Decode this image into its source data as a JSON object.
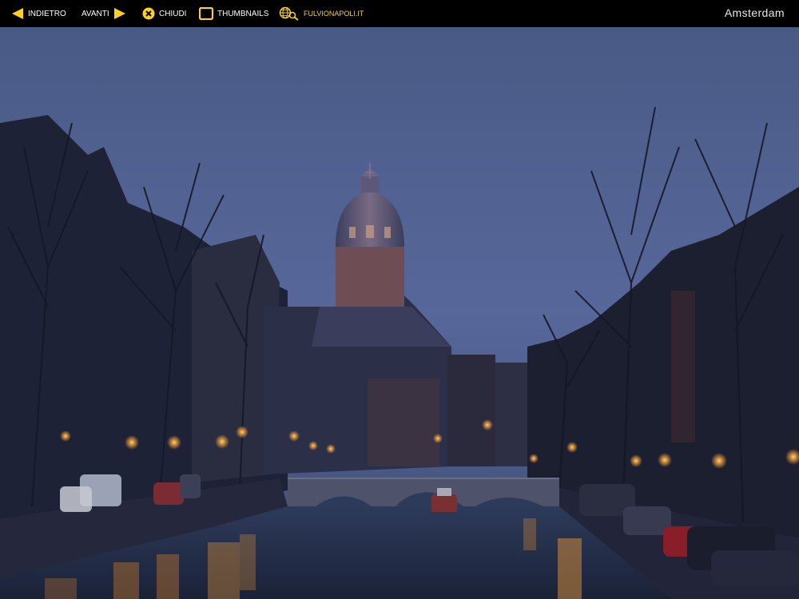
{
  "nav": {
    "back_label": "INDIETRO",
    "next_label": "AVANTI",
    "close_label": "CHIUDI",
    "thumbnails_label": "THUMBNAILS",
    "site_label": "FULVIONAPOLI.IT"
  },
  "page": {
    "title": "Amsterdam"
  },
  "colors": {
    "accent": "#ffd21f",
    "bar": "#000000",
    "text": "#ffffff"
  },
  "icons": {
    "back": "arrow-left-icon",
    "next": "arrow-right-icon",
    "close": "close-circle-icon",
    "thumbnails": "thumbnails-square-icon",
    "site": "globe-magnifier-icon"
  }
}
